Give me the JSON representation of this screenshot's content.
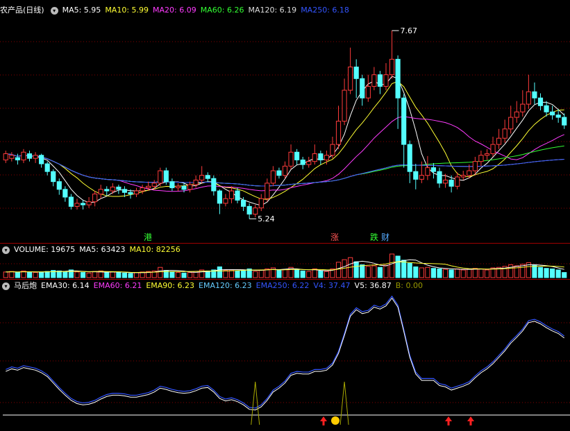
{
  "colors": {
    "background": "#000000",
    "up": "#ff3b3b",
    "down": "#54ffff",
    "ma5": "#ffffff",
    "ma10": "#ffff33",
    "ma20": "#ff3cff",
    "ma60": "#33ff33",
    "ma120": "#dddddd",
    "ma250": "#3355ff",
    "grid": "#8a0000",
    "separator": "#a00000"
  },
  "price_panel": {
    "title": "农产品(日线)",
    "indicators": [
      {
        "label": "MA5: 5.95",
        "color": "#ffffff"
      },
      {
        "label": "MA10: 5.99",
        "color": "#ffff33"
      },
      {
        "label": "MA20: 6.09",
        "color": "#ff3cff"
      },
      {
        "label": "MA60: 6.26",
        "color": "#33ff33"
      },
      {
        "label": "MA120: 6.19",
        "color": "#dddddd"
      },
      {
        "label": "MA250: 6.18",
        "color": "#3355ff"
      }
    ],
    "high_label": "7.67",
    "low_label": "5.24",
    "markers": [
      {
        "text": "港",
        "color": "#33ff33"
      },
      {
        "text": "涨",
        "color": "#ff5555"
      },
      {
        "text": "跌",
        "color": "#33ff33"
      },
      {
        "text": "财",
        "color": "#55aaff"
      }
    ]
  },
  "volume_panel": {
    "indicators": [
      {
        "label": "VOLUME: 19675",
        "color": "#ffffff"
      },
      {
        "label": "MA5: 63423",
        "color": "#ffffff"
      },
      {
        "label": "MA10: 82256",
        "color": "#ffff33"
      }
    ]
  },
  "indicator_panel": {
    "title": "马后炮",
    "indicators": [
      {
        "label": "EMA30: 6.14",
        "color": "#ffffff"
      },
      {
        "label": "EMA60: 6.21",
        "color": "#ff3cff"
      },
      {
        "label": "EMA90: 6.23",
        "color": "#ffff33"
      },
      {
        "label": "EMA120: 6.23",
        "color": "#66ccff"
      },
      {
        "label": "EMA250: 6.22",
        "color": "#3355ff"
      },
      {
        "label": "V4: 37.47",
        "color": "#3355ff"
      },
      {
        "label": "V5: 36.87",
        "color": "#ffffff"
      },
      {
        "label": "B: 0.00",
        "color": "#999900"
      }
    ]
  },
  "chart_data": {
    "type": "candlestick",
    "price_range": [
      5.0,
      7.85
    ],
    "candles": [
      [
        6.0,
        6.08,
        5.96,
        6.12
      ],
      [
        6.02,
        6.06,
        5.98,
        6.1
      ],
      [
        6.03,
        6.0,
        5.94,
        6.08
      ],
      [
        6.0,
        6.1,
        5.96,
        6.14
      ],
      [
        6.08,
        6.02,
        5.98,
        6.12
      ],
      [
        6.02,
        6.06,
        5.96,
        6.1
      ],
      [
        6.06,
        5.95,
        5.9,
        6.08
      ],
      [
        5.95,
        5.85,
        5.8,
        5.98
      ],
      [
        5.85,
        5.72,
        5.66,
        5.88
      ],
      [
        5.72,
        5.62,
        5.55,
        5.76
      ],
      [
        5.62,
        5.52,
        5.46,
        5.66
      ],
      [
        5.52,
        5.4,
        5.36,
        5.56
      ],
      [
        5.4,
        5.44,
        5.36,
        5.5
      ],
      [
        5.44,
        5.42,
        5.36,
        5.48
      ],
      [
        5.42,
        5.46,
        5.38,
        5.52
      ],
      [
        5.46,
        5.56,
        5.4,
        5.6
      ],
      [
        5.56,
        5.62,
        5.5,
        5.68
      ],
      [
        5.62,
        5.6,
        5.54,
        5.66
      ],
      [
        5.6,
        5.65,
        5.56,
        5.7
      ],
      [
        5.65,
        5.62,
        5.56,
        5.68
      ],
      [
        5.62,
        5.58,
        5.52,
        5.66
      ],
      [
        5.58,
        5.56,
        5.5,
        5.62
      ],
      [
        5.56,
        5.6,
        5.52,
        5.64
      ],
      [
        5.6,
        5.64,
        5.56,
        5.68
      ],
      [
        5.64,
        5.66,
        5.6,
        5.72
      ],
      [
        5.66,
        5.7,
        5.62,
        5.74
      ],
      [
        5.7,
        5.86,
        5.66,
        5.9
      ],
      [
        5.86,
        5.72,
        5.68,
        5.9
      ],
      [
        5.72,
        5.64,
        5.6,
        5.76
      ],
      [
        5.64,
        5.66,
        5.6,
        5.7
      ],
      [
        5.66,
        5.62,
        5.58,
        5.7
      ],
      [
        5.62,
        5.68,
        5.58,
        5.72
      ],
      [
        5.68,
        5.74,
        5.64,
        5.8
      ],
      [
        5.74,
        5.8,
        5.7,
        5.92
      ],
      [
        5.8,
        5.76,
        5.72,
        5.84
      ],
      [
        5.76,
        5.6,
        5.54,
        5.8
      ],
      [
        5.6,
        5.44,
        5.3,
        5.62
      ],
      [
        5.44,
        5.5,
        5.4,
        5.56
      ],
      [
        5.5,
        5.6,
        5.44,
        5.66
      ],
      [
        5.6,
        5.48,
        5.44,
        5.64
      ],
      [
        5.48,
        5.4,
        5.34,
        5.52
      ],
      [
        5.4,
        5.3,
        5.24,
        5.44
      ],
      [
        5.3,
        5.38,
        5.26,
        5.42
      ],
      [
        5.38,
        5.5,
        5.34,
        5.56
      ],
      [
        5.5,
        5.7,
        5.46,
        5.76
      ],
      [
        5.7,
        5.86,
        5.66,
        5.92
      ],
      [
        5.86,
        5.8,
        5.76,
        5.9
      ],
      [
        5.8,
        5.92,
        5.76,
        5.98
      ],
      [
        5.92,
        6.1,
        5.88,
        6.2
      ],
      [
        6.1,
        6.0,
        5.94,
        6.14
      ],
      [
        6.0,
        5.94,
        5.88,
        6.04
      ],
      [
        5.94,
        5.98,
        5.9,
        6.04
      ],
      [
        5.98,
        6.08,
        5.94,
        6.2
      ],
      [
        6.08,
        6.0,
        5.94,
        6.12
      ],
      [
        6.0,
        6.06,
        5.94,
        6.12
      ],
      [
        6.06,
        6.2,
        6.02,
        6.3
      ],
      [
        6.2,
        6.5,
        6.14,
        6.7
      ],
      [
        6.5,
        6.9,
        6.45,
        7.05
      ],
      [
        6.9,
        7.2,
        6.85,
        7.45
      ],
      [
        7.2,
        7.05,
        6.8,
        7.3
      ],
      [
        7.05,
        6.8,
        6.7,
        7.1
      ],
      [
        6.8,
        6.95,
        6.75,
        7.1
      ],
      [
        6.95,
        7.1,
        6.9,
        7.2
      ],
      [
        7.1,
        6.95,
        6.85,
        7.15
      ],
      [
        6.95,
        7.1,
        6.9,
        7.25
      ],
      [
        7.1,
        7.3,
        7.05,
        7.67
      ],
      [
        7.3,
        6.8,
        6.4,
        7.35
      ],
      [
        6.8,
        6.2,
        5.9,
        6.85
      ],
      [
        6.2,
        5.85,
        5.7,
        6.25
      ],
      [
        5.85,
        5.75,
        5.62,
        5.95
      ],
      [
        5.75,
        5.8,
        5.7,
        5.98
      ],
      [
        5.8,
        5.9,
        5.74,
        6.05
      ],
      [
        5.9,
        5.85,
        5.76,
        5.96
      ],
      [
        5.85,
        5.7,
        5.64,
        5.9
      ],
      [
        5.7,
        5.74,
        5.64,
        5.82
      ],
      [
        5.74,
        5.66,
        5.58,
        5.8
      ],
      [
        5.66,
        5.78,
        5.62,
        5.84
      ],
      [
        5.78,
        5.8,
        5.74,
        5.86
      ],
      [
        5.8,
        5.86,
        5.76,
        5.94
      ],
      [
        5.86,
        5.98,
        5.8,
        6.04
      ],
      [
        5.98,
        6.06,
        5.92,
        6.12
      ],
      [
        6.06,
        6.08,
        6.0,
        6.14
      ],
      [
        6.08,
        6.2,
        6.04,
        6.3
      ],
      [
        6.2,
        6.28,
        6.14,
        6.4
      ],
      [
        6.28,
        6.4,
        6.22,
        6.52
      ],
      [
        6.4,
        6.55,
        6.34,
        6.7
      ],
      [
        6.55,
        6.62,
        6.48,
        6.76
      ],
      [
        6.62,
        6.72,
        6.56,
        6.9
      ],
      [
        6.72,
        6.88,
        6.66,
        7.1
      ],
      [
        6.88,
        6.8,
        6.72,
        7.0
      ],
      [
        6.8,
        6.7,
        6.64,
        6.86
      ],
      [
        6.7,
        6.62,
        6.56,
        6.76
      ],
      [
        6.62,
        6.58,
        6.52,
        6.7
      ],
      [
        6.58,
        6.55,
        6.48,
        6.66
      ],
      [
        6.55,
        6.45,
        6.4,
        6.6
      ]
    ],
    "volumes": [
      22,
      24,
      20,
      26,
      22,
      20,
      22,
      24,
      28,
      26,
      24,
      30,
      22,
      20,
      18,
      24,
      26,
      20,
      22,
      20,
      18,
      16,
      20,
      22,
      24,
      26,
      40,
      28,
      22,
      20,
      18,
      20,
      24,
      30,
      26,
      30,
      42,
      28,
      30,
      26,
      28,
      34,
      24,
      30,
      34,
      38,
      30,
      32,
      40,
      30,
      26,
      24,
      34,
      26,
      24,
      34,
      60,
      70,
      78,
      62,
      50,
      44,
      46,
      40,
      48,
      92,
      84,
      68,
      56,
      42,
      38,
      40,
      36,
      34,
      32,
      30,
      34,
      30,
      34,
      36,
      34,
      30,
      38,
      40,
      44,
      50,
      46,
      52,
      58,
      48,
      40,
      36,
      34,
      30,
      20
    ],
    "ema30": [
      6.0,
      6.04,
      6.02,
      6.06,
      6.04,
      6.02,
      5.98,
      5.92,
      5.82,
      5.72,
      5.63,
      5.55,
      5.5,
      5.48,
      5.49,
      5.52,
      5.57,
      5.61,
      5.63,
      5.63,
      5.62,
      5.6,
      5.6,
      5.62,
      5.64,
      5.68,
      5.74,
      5.72,
      5.69,
      5.67,
      5.66,
      5.67,
      5.7,
      5.74,
      5.75,
      5.68,
      5.58,
      5.54,
      5.56,
      5.53,
      5.48,
      5.41,
      5.4,
      5.45,
      5.55,
      5.68,
      5.74,
      5.82,
      5.94,
      5.97,
      5.96,
      5.96,
      6.0,
      6.0,
      6.02,
      6.1,
      6.28,
      6.56,
      6.86,
      6.96,
      6.9,
      6.92,
      7.0,
      6.97,
      7.02,
      7.14,
      7.0,
      6.62,
      6.22,
      5.96,
      5.86,
      5.86,
      5.86,
      5.78,
      5.76,
      5.71,
      5.74,
      5.77,
      5.81,
      5.9,
      5.98,
      6.04,
      6.12,
      6.22,
      6.32,
      6.44,
      6.53,
      6.63,
      6.76,
      6.78,
      6.74,
      6.68,
      6.63,
      6.59,
      6.52
    ],
    "b_signal": [
      0,
      0,
      0,
      0,
      0,
      0,
      0,
      0,
      0,
      0,
      0,
      0,
      0,
      0,
      0,
      0,
      0,
      0,
      0,
      0,
      0,
      0,
      0,
      0,
      0,
      0,
      0,
      0,
      0,
      0,
      0,
      0,
      0,
      0,
      0,
      0,
      0,
      0,
      0,
      0,
      0,
      0,
      1,
      0,
      0,
      0,
      0,
      0,
      0,
      0,
      0,
      0,
      0,
      0,
      0,
      0,
      0,
      1,
      0,
      0,
      0,
      0,
      0,
      0,
      0,
      0,
      0,
      0,
      0,
      0,
      0,
      0,
      0,
      0,
      0,
      0,
      0,
      0,
      0,
      0,
      0,
      0,
      0,
      0,
      0,
      0,
      0,
      0,
      0,
      0,
      0,
      0,
      0,
      0,
      0,
      0
    ]
  }
}
